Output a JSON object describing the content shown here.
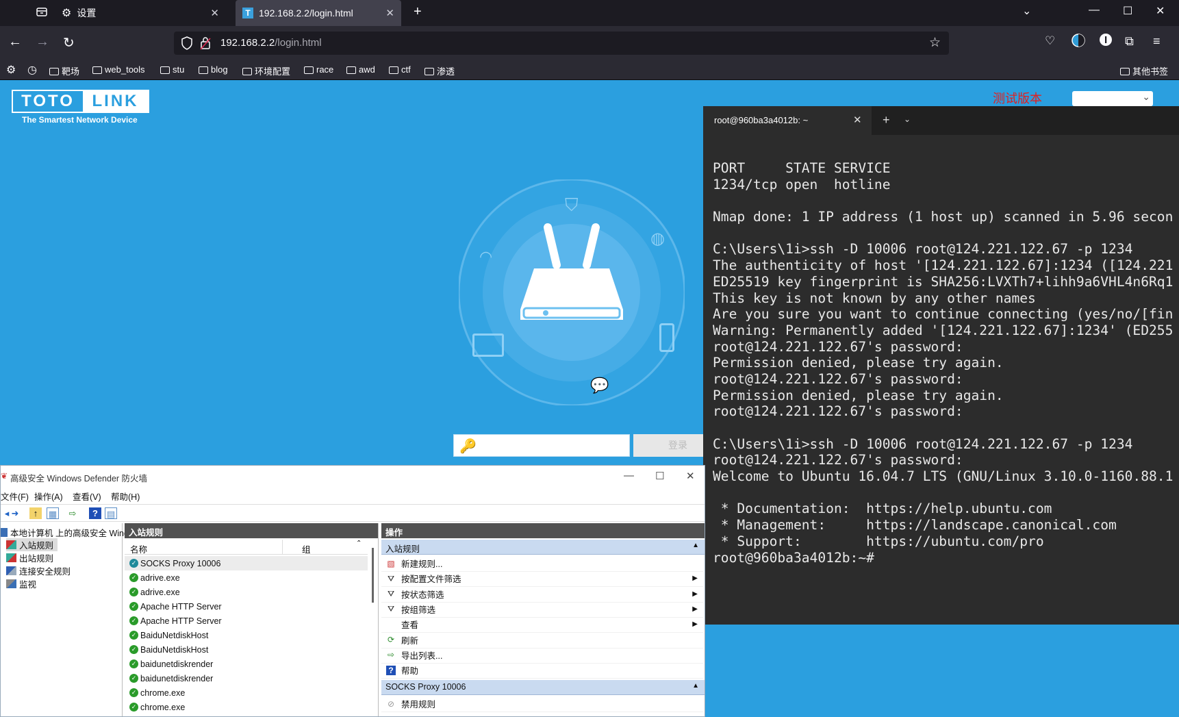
{
  "browser": {
    "tabs": [
      {
        "label": "设置"
      },
      {
        "label": "192.168.2.2/login.html"
      }
    ],
    "url": {
      "host": "192.168.2.2",
      "path": "/login.html"
    },
    "bookmarks": [
      "靶场",
      "web_tools",
      "stu",
      "blog",
      "环境配置",
      "race",
      "awd",
      "ctf",
      "渗透"
    ],
    "other_bookmarks": "其他书签"
  },
  "router": {
    "logo_left": "TOTO",
    "logo_right": "LINK",
    "tagline": "The Smartest Network Device",
    "test_version": "测试版本",
    "login_button": "登录"
  },
  "terminal": {
    "tab_title": "root@960ba3a4012b: ~",
    "lines": [
      "PORT     STATE SERVICE",
      "1234/tcp open  hotline",
      "",
      "Nmap done: 1 IP address (1 host up) scanned in 5.96 secon",
      "",
      "C:\\Users\\1i>ssh -D 10006 root@124.221.122.67 -p 1234",
      "The authenticity of host '[124.221.122.67]:1234 ([124.221",
      "ED25519 key fingerprint is SHA256:LVXTh7+lihh9a6VHL4n6Rq1",
      "This key is not known by any other names",
      "Are you sure you want to continue connecting (yes/no/[fin",
      "Warning: Permanently added '[124.221.122.67]:1234' (ED255",
      "root@124.221.122.67's password:",
      "Permission denied, please try again.",
      "root@124.221.122.67's password:",
      "Permission denied, please try again.",
      "root@124.221.122.67's password:",
      "",
      "C:\\Users\\1i>ssh -D 10006 root@124.221.122.67 -p 1234",
      "root@124.221.122.67's password:",
      "Welcome to Ubuntu 16.04.7 LTS (GNU/Linux 3.10.0-1160.88.1",
      "",
      " * Documentation:  https://help.ubuntu.com",
      " * Management:     https://landscape.canonical.com",
      " * Support:        https://ubuntu.com/pro",
      "root@960ba3a4012b:~#"
    ]
  },
  "firewall": {
    "title": "高级安全 Windows Defender 防火墙",
    "menu": [
      "文件(F)",
      "操作(A)",
      "查看(V)",
      "帮助(H)"
    ],
    "tree": {
      "root": "本地计算机 上的高级安全 Wind",
      "items": [
        "入站规则",
        "出站规则",
        "连接安全规则",
        "监视"
      ]
    },
    "mid_header": "入站规则",
    "columns": {
      "name": "名称",
      "group": "组"
    },
    "rules": [
      "SOCKS Proxy 10006",
      "adrive.exe",
      "adrive.exe",
      "Apache HTTP Server",
      "Apache HTTP Server",
      "BaiduNetdiskHost",
      "BaiduNetdiskHost",
      "baidunetdiskrender",
      "baidunetdiskrender",
      "chrome.exe",
      "chrome.exe"
    ],
    "actions_header": "操作",
    "actions_section": "入站规则",
    "actions": [
      {
        "label": "新建规则...",
        "submenu": false
      },
      {
        "label": "按配置文件筛选",
        "submenu": true
      },
      {
        "label": "按状态筛选",
        "submenu": true
      },
      {
        "label": "按组筛选",
        "submenu": true
      },
      {
        "label": "查看",
        "submenu": true
      },
      {
        "label": "刷新",
        "submenu": false
      },
      {
        "label": "导出列表...",
        "submenu": false
      },
      {
        "label": "帮助",
        "submenu": false
      }
    ],
    "selected_section": "SOCKS Proxy 10006",
    "selected_first_action": "禁用规则"
  }
}
